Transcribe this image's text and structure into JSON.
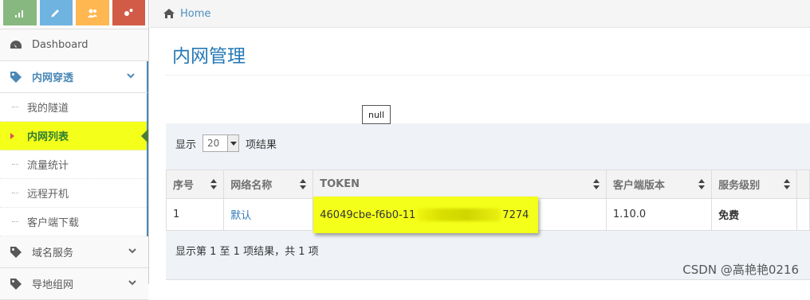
{
  "sidebar": {
    "shortcuts": [
      {
        "icon": "signal-icon",
        "color": "#87b87f"
      },
      {
        "icon": "pencil-icon",
        "color": "#6fb3e0"
      },
      {
        "icon": "users-icon",
        "color": "#ffb752"
      },
      {
        "icon": "cogs-icon",
        "color": "#d15b47"
      }
    ],
    "dashboard_label": "Dashboard",
    "tunnel_group_label": "内网穿透",
    "tunnel_items": [
      "我的隧道",
      "内网列表",
      "流量统计",
      "远程开机",
      "客户端下载"
    ],
    "domain_group_label": "域名服务",
    "last_group_label": "导地组网"
  },
  "breadcrumb": {
    "home_label": "Home"
  },
  "page": {
    "title": "内网管理"
  },
  "tooltip": {
    "text": "null"
  },
  "table_controls": {
    "length_prefix": "显示",
    "length_value": "20",
    "length_suffix": "项结果"
  },
  "table": {
    "headers": [
      "序号",
      "网络名称",
      "TOKEN",
      "客户端版本",
      "服务级别"
    ],
    "rows": [
      {
        "index": "1",
        "name": "默认",
        "token_start": "46049cbe-f6b0-11",
        "token_end": "7274",
        "version": "1.10.0",
        "level": "免费"
      }
    ]
  },
  "info_text": "显示第 1 至 1 项结果，共 1 项",
  "watermark": "CSDN @高艳艳0216",
  "colors": {
    "accent": "#2679b5",
    "highlight": "#f4ff1a"
  }
}
